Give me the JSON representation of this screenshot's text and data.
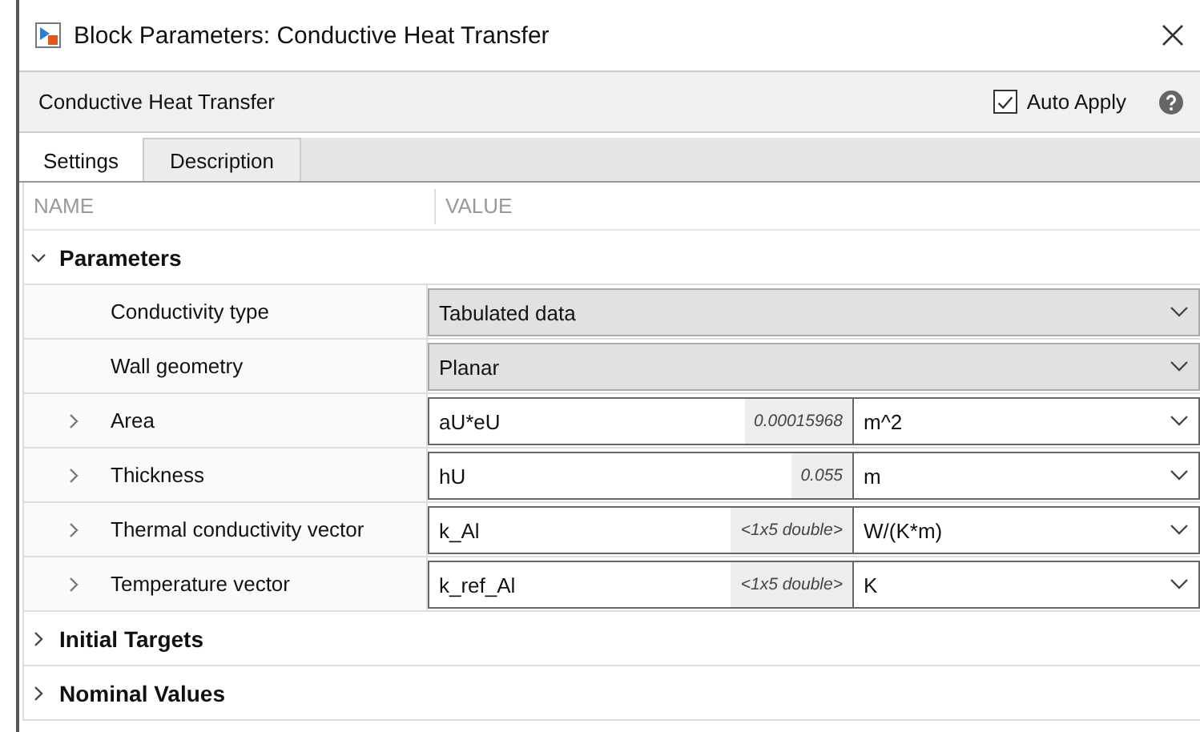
{
  "window": {
    "title": "Block Parameters: Conductive Heat Transfer"
  },
  "header": {
    "block_name": "Conductive Heat Transfer",
    "auto_apply": {
      "label": "Auto Apply",
      "checked": true
    }
  },
  "tabs": [
    {
      "label": "Settings",
      "selected": true
    },
    {
      "label": "Description",
      "selected": false
    }
  ],
  "table": {
    "columns": [
      "NAME",
      "VALUE"
    ],
    "sections": [
      {
        "title": "Parameters",
        "expanded": true,
        "rows": [
          {
            "kind": "dropdown",
            "name": "Conductivity type",
            "value": "Tabulated data"
          },
          {
            "kind": "dropdown",
            "name": "Wall geometry",
            "value": "Planar"
          },
          {
            "kind": "value_unit",
            "name": "Area",
            "expandable": true,
            "expression": "aU*eU",
            "evaluated": "0.00015968",
            "unit": "m^2"
          },
          {
            "kind": "value_unit",
            "name": "Thickness",
            "expandable": true,
            "expression": "hU",
            "evaluated": "0.055",
            "unit": "m"
          },
          {
            "kind": "value_unit",
            "name": "Thermal conductivity vector",
            "expandable": true,
            "expression": "k_Al",
            "evaluated": "<1x5 double>",
            "unit": "W/(K*m)"
          },
          {
            "kind": "value_unit",
            "name": "Temperature vector",
            "expandable": true,
            "expression": "k_ref_Al",
            "evaluated": "<1x5 double>",
            "unit": "K"
          }
        ]
      },
      {
        "title": "Initial Targets",
        "expanded": false
      },
      {
        "title": "Nominal Values",
        "expanded": false
      }
    ]
  }
}
